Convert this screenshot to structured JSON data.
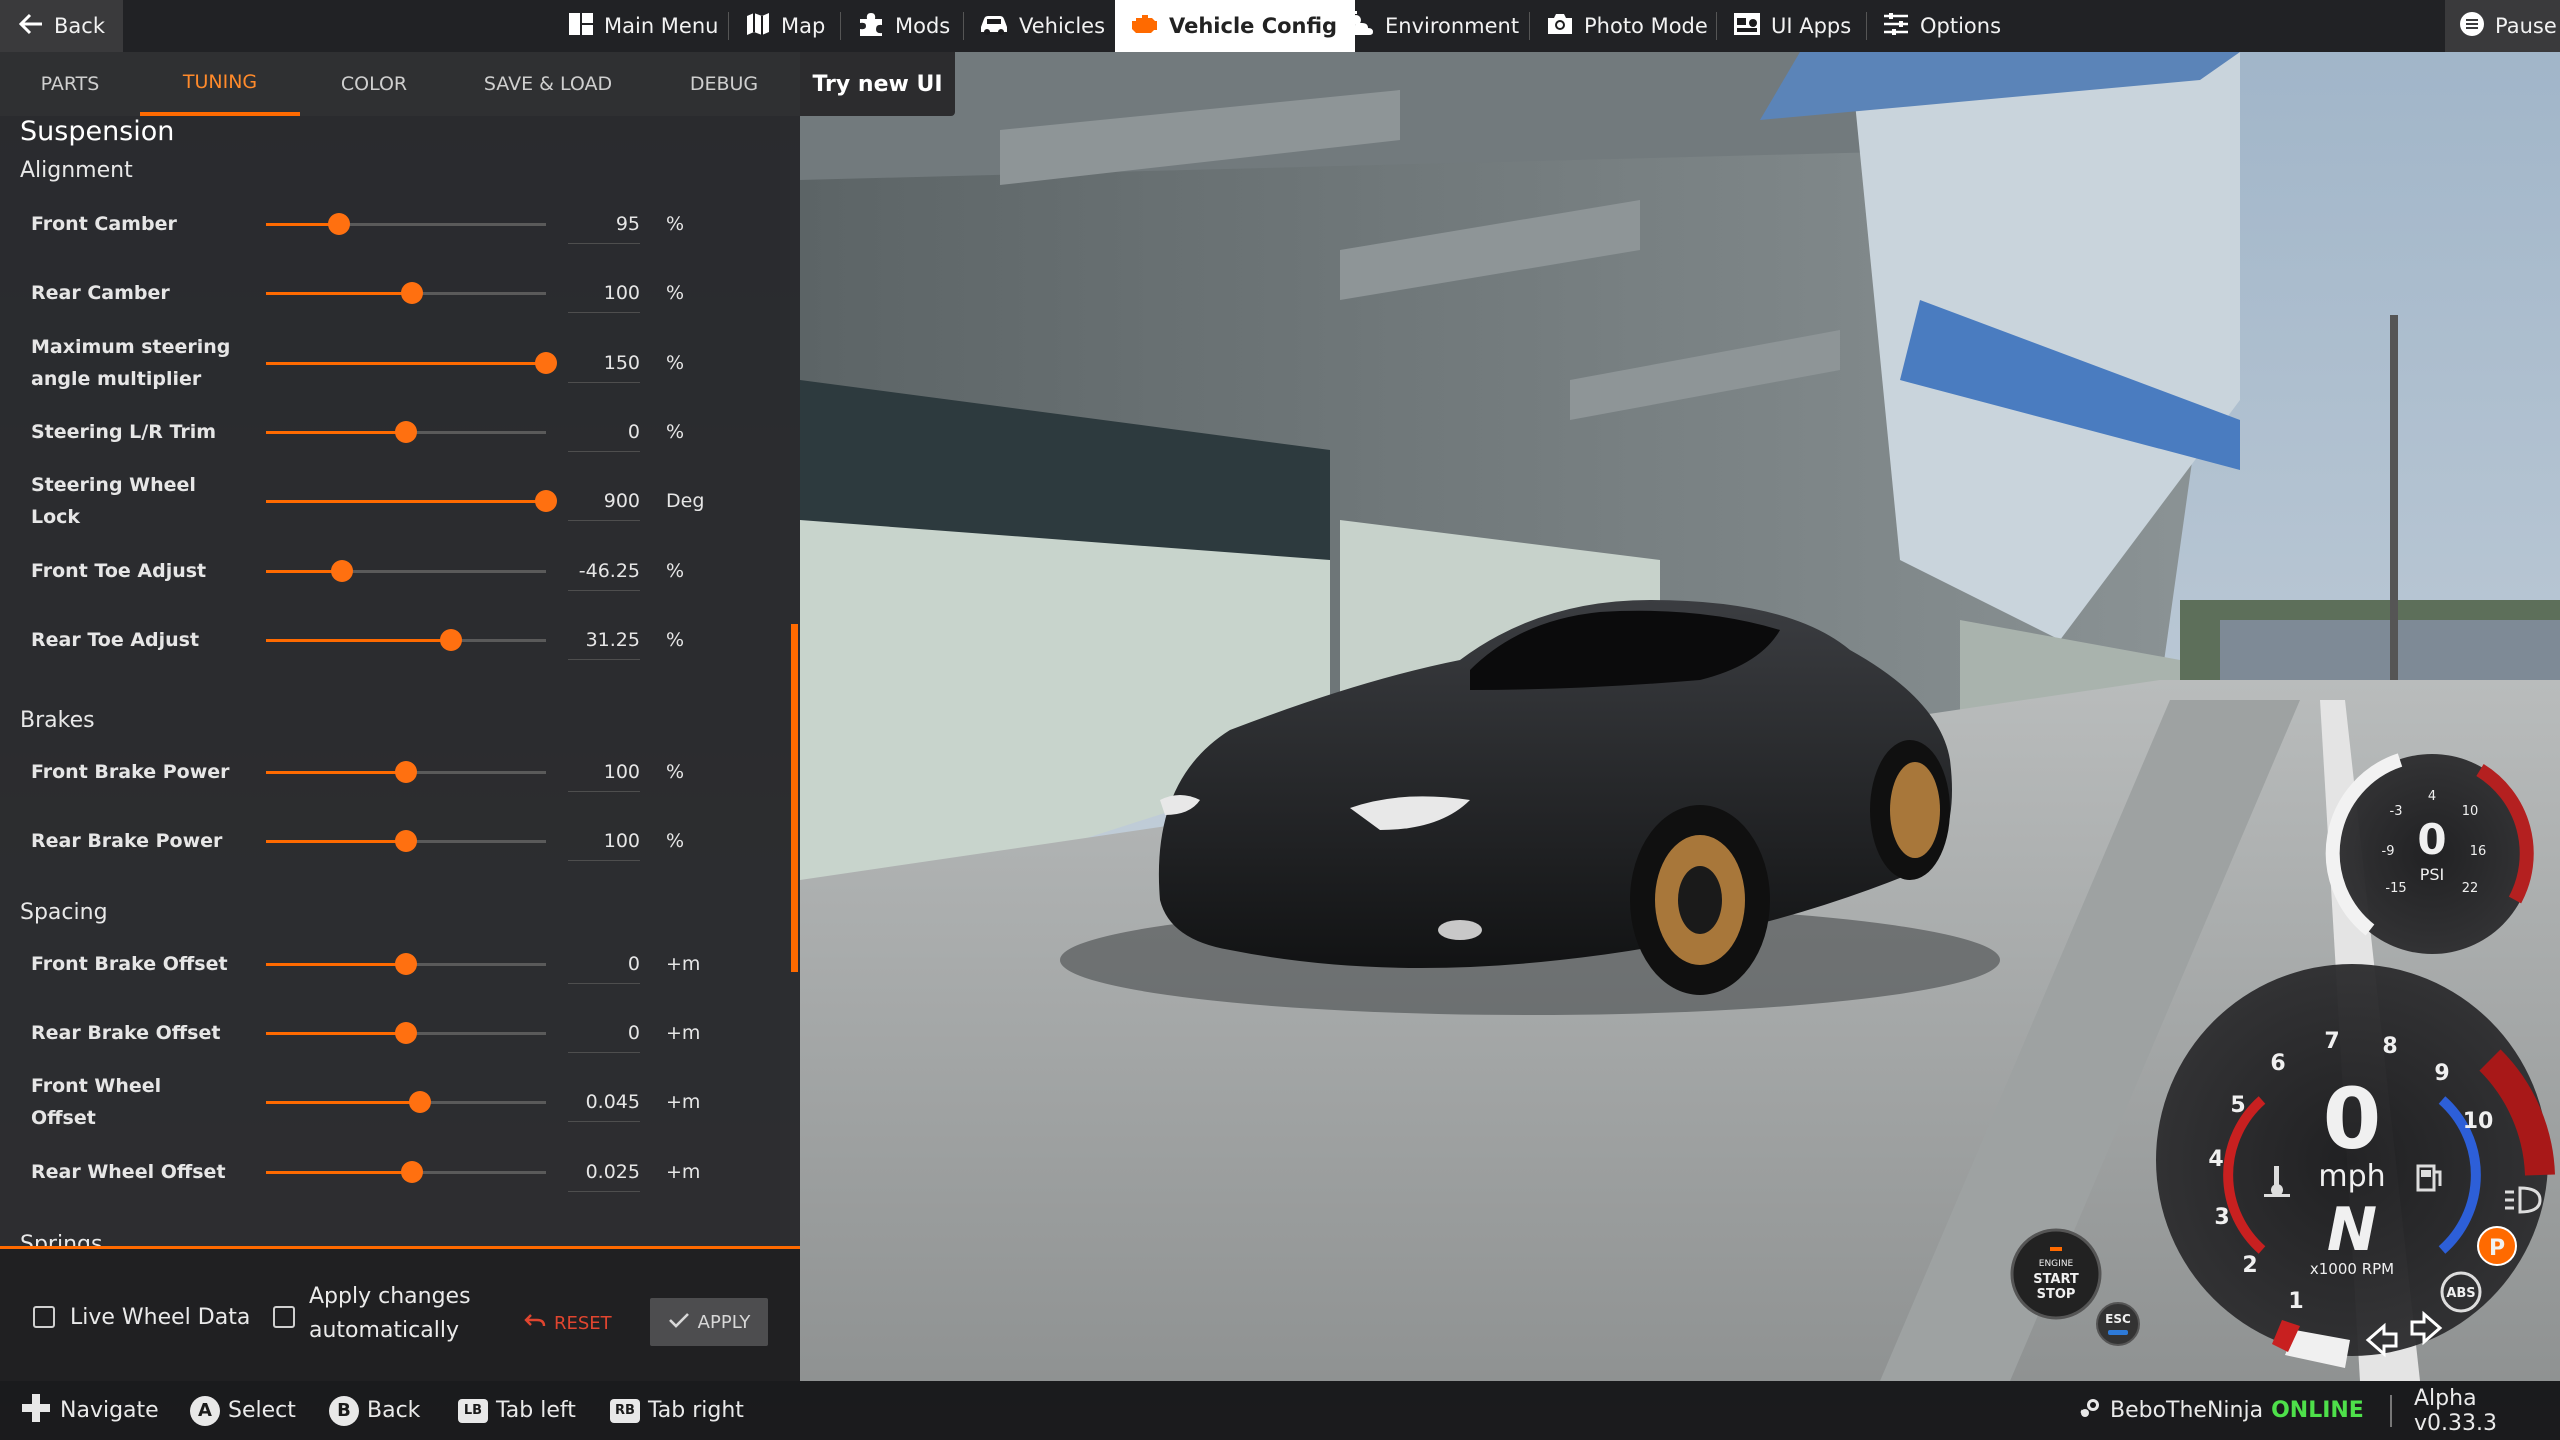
{
  "topbar": {
    "back": "Back",
    "items": [
      "Main Menu",
      "Map",
      "Mods",
      "Vehicles",
      "Vehicle Config",
      "Environment",
      "Photo Mode",
      "UI Apps",
      "Options"
    ],
    "pause": "Pause"
  },
  "tabs": [
    "PARTS",
    "TUNING",
    "COLOR",
    "SAVE & LOAD",
    "DEBUG"
  ],
  "active_tab": "TUNING",
  "try_new_ui": "Try new UI",
  "tuning": {
    "section": "Suspension",
    "groups": {
      "alignment": "Alignment",
      "brakes": "Brakes",
      "spacing": "Spacing",
      "springs": "Springs"
    },
    "rows": [
      {
        "label": "Front Camber",
        "value": "95",
        "unit": "%",
        "level": 0.26
      },
      {
        "label": "Rear Camber",
        "value": "100",
        "unit": "%",
        "level": 0.52
      },
      {
        "label": "Maximum steering angle multiplier",
        "value": "150",
        "unit": "%",
        "level": 1.0
      },
      {
        "label": "Steering L/R Trim",
        "value": "0",
        "unit": "%",
        "level": 0.5
      },
      {
        "label": "Steering Wheel Lock",
        "value": "900",
        "unit": "Deg",
        "level": 1.0
      },
      {
        "label": "Front Toe Adjust",
        "value": "-46.25",
        "unit": "%",
        "level": 0.27
      },
      {
        "label": "Rear Toe Adjust",
        "value": "31.25",
        "unit": "%",
        "level": 0.66
      },
      {
        "label": "Front Brake Power",
        "value": "100",
        "unit": "%",
        "level": 0.5
      },
      {
        "label": "Rear Brake Power",
        "value": "100",
        "unit": "%",
        "level": 0.5
      },
      {
        "label": "Front Brake Offset",
        "value": "0",
        "unit": "+m",
        "level": 0.5
      },
      {
        "label": "Rear Brake Offset",
        "value": "0",
        "unit": "+m",
        "level": 0.5
      },
      {
        "label": "Front Wheel Offset",
        "value": "0.045",
        "unit": "+m",
        "level": 0.55
      },
      {
        "label": "Rear Wheel Offset",
        "value": "0.025",
        "unit": "+m",
        "level": 0.52
      }
    ]
  },
  "footer": {
    "live_wheel_data": "Live Wheel Data",
    "apply_auto_line1": "Apply changes",
    "apply_auto_line2": "automatically",
    "reset": "RESET",
    "apply": "APPLY"
  },
  "bottombar": {
    "navigate": "Navigate",
    "select": "Select",
    "back": "Back",
    "tab_left": "Tab left",
    "tab_right": "Tab right",
    "select_key": "A",
    "back_key": "B",
    "tab_left_key": "LB",
    "tab_right_key": "RB",
    "user": "BeboTheNinja",
    "status": "ONLINE",
    "version": "Alpha v0.33.3"
  },
  "hud": {
    "boost": {
      "value": "0",
      "unit": "PSI",
      "ticks": [
        "-15",
        "-9",
        "-3",
        "4",
        "10",
        "16",
        "22"
      ]
    },
    "tacho": {
      "speed": "0",
      "speed_unit": "mph",
      "gear": "N",
      "rpm_label": "x1000 RPM",
      "rpm_ticks": [
        "1",
        "2",
        "3",
        "4",
        "5",
        "6",
        "7",
        "8",
        "9",
        "10"
      ]
    },
    "engine_button": {
      "line1": "ENGINE",
      "line2": "START",
      "line3": "STOP"
    },
    "esc_label": "ESC",
    "abs_label": "ABS",
    "park_label": "P"
  },
  "colors": {
    "accent": "#ff6a00",
    "online": "#4ee04a",
    "reset": "#e0452f"
  }
}
